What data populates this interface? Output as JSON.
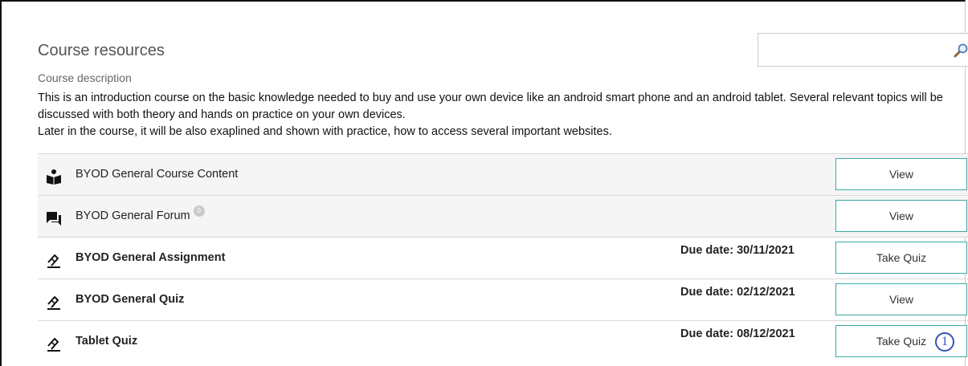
{
  "page": {
    "title": "Course resources",
    "search": {
      "placeholder": "",
      "value": ""
    }
  },
  "description": {
    "label": "Course description",
    "lines": [
      "This is an introduction course on the basic knowledge needed to buy and use your own device like an android smart phone and an android tablet. Several relevant topics will be discussed with both theory and hands on practice on your own devices.",
      "Later in the course, it will be also exaplined and shown with practice, how to access several important websites."
    ]
  },
  "resources": [
    {
      "icon": "book-reader-icon",
      "title": "BYOD General Course Content",
      "due": "",
      "action": "View"
    },
    {
      "icon": "forum-icon",
      "title": "BYOD General Forum",
      "badge": "0",
      "due": "",
      "action": "View"
    },
    {
      "icon": "quiz-icon",
      "title": "BYOD General Assignment",
      "due": "Due date: 30/11/2021",
      "action": "Take Quiz"
    },
    {
      "icon": "quiz-icon",
      "title": "BYOD General Quiz",
      "due": "Due date: 02/12/2021",
      "action": "View"
    },
    {
      "icon": "quiz-icon",
      "title": "Tablet Quiz",
      "due": "Due date: 08/12/2021",
      "action": "Take Quiz"
    }
  ],
  "annotation": {
    "marker": "1"
  },
  "colors": {
    "button_border": "#3aa9a1",
    "callout": "#2f55b5",
    "row_shaded": "#f5f5f5"
  }
}
